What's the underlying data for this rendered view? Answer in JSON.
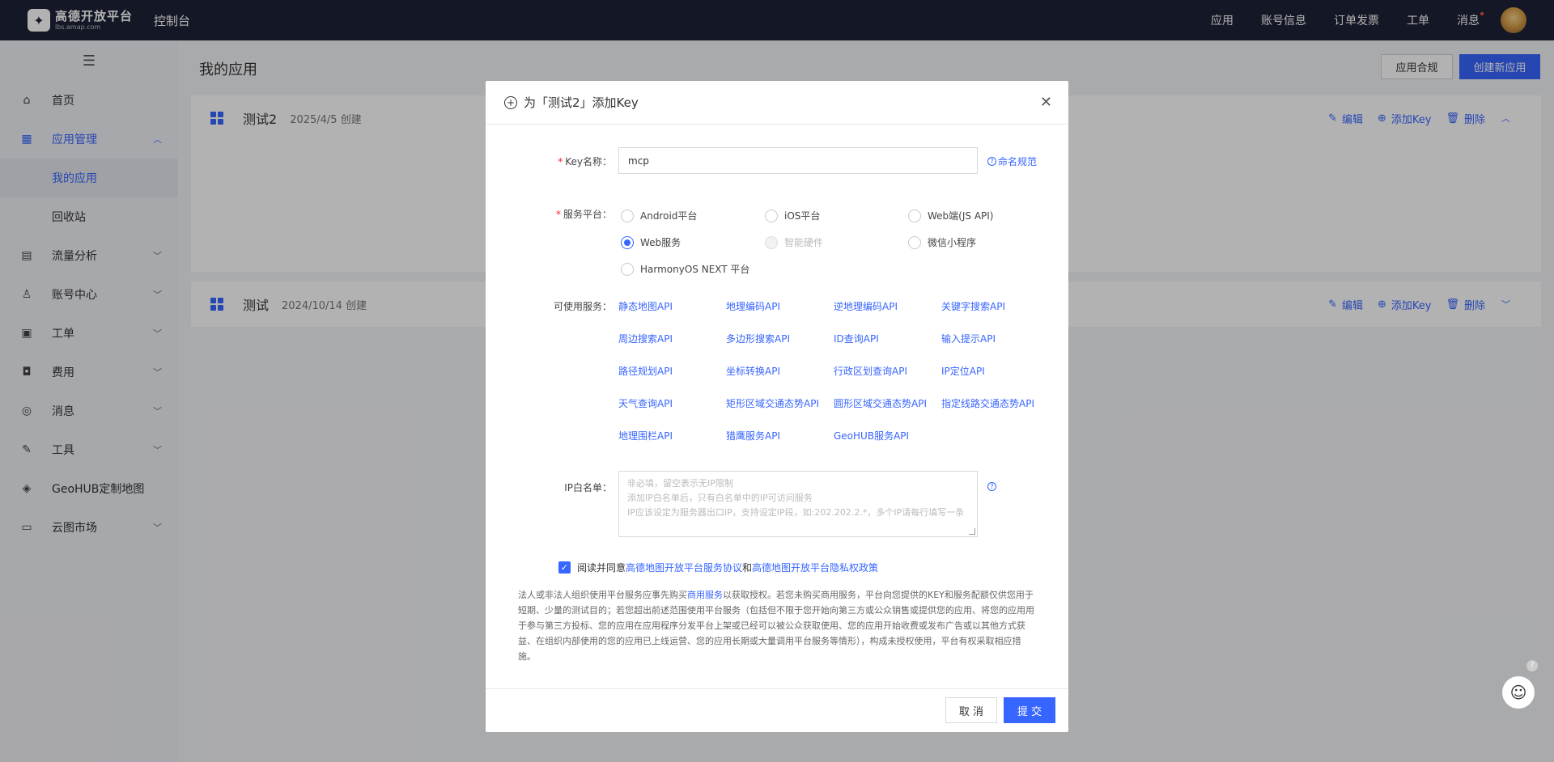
{
  "topbar": {
    "logo_main": "高德开放平台",
    "logo_sub": "lbs.amap.com",
    "console": "控制台",
    "nav": [
      "应用",
      "账号信息",
      "订单发票",
      "工单",
      "消息"
    ]
  },
  "sidebar": {
    "toggle_icon": "hamburger-icon",
    "items": [
      {
        "label": "首页",
        "icon": "home-icon"
      },
      {
        "label": "应用管理",
        "icon": "apps-icon"
      },
      {
        "label": "我的应用"
      },
      {
        "label": "回收站"
      },
      {
        "label": "流量分析",
        "icon": "chart-icon"
      },
      {
        "label": "账号中心",
        "icon": "user-icon"
      },
      {
        "label": "工单",
        "icon": "ticket-icon"
      },
      {
        "label": "费用",
        "icon": "billing-icon"
      },
      {
        "label": "消息",
        "icon": "message-icon"
      },
      {
        "label": "工具",
        "icon": "wrench-icon"
      },
      {
        "label": "GeoHUB定制地图",
        "icon": "layers-icon"
      },
      {
        "label": "云图市场",
        "icon": "store-icon"
      }
    ]
  },
  "main": {
    "title": "我的应用",
    "compliance_button": "应用合规",
    "create_button": "创建新应用",
    "apps": [
      {
        "name": "测试2",
        "date": "2025/4/5 创建",
        "edit": "编辑",
        "add_key": "添加Key",
        "delete": "删除"
      },
      {
        "name": "测试",
        "date": "2024/10/14 创建",
        "edit": "编辑",
        "add_key": "添加Key",
        "delete": "删除"
      }
    ]
  },
  "modal": {
    "title": "为「测试2」添加Key",
    "key_name_label": "Key名称：",
    "key_name_value": "mcp",
    "naming_link": "命名规范",
    "platform_label": "服务平台：",
    "platforms": [
      "Android平台",
      "iOS平台",
      "Web端(JS API)",
      "Web服务",
      "智能硬件",
      "微信小程序",
      "HarmonyOS NEXT 平台"
    ],
    "selected_platform": "Web服务",
    "services_label": "可使用服务：",
    "services": [
      "静态地图API",
      "地理编码API",
      "逆地理编码API",
      "关键字搜索API",
      "周边搜索API",
      "多边形搜索API",
      "ID查询API",
      "输入提示API",
      "路径规划API",
      "坐标转换API",
      "行政区划查询API",
      "IP定位API",
      "天气查询API",
      "矩形区域交通态势API",
      "圆形区域交通态势API",
      "指定线路交通态势API",
      "地理围栏API",
      "猎鹰服务API",
      "GeoHUB服务API"
    ],
    "ip_label": "IP白名单：",
    "ip_placeholder_1": "非必填，留空表示无IP限制",
    "ip_placeholder_2": "添加IP白名单后，只有白名单中的IP可访问服务",
    "ip_placeholder_3": "IP应该设定为服务器出口IP，支持设定IP段，如:202.202.2.*，多个IP请每行填写一条",
    "agree_prefix": "阅读并同意 ",
    "agree_link_1": "高德地图开放平台服务协议",
    "agree_and": " 和 ",
    "agree_link_2": "高德地图开放平台隐私权政策",
    "notice_1": "法人或非法人组织使用平台服务应事先购买",
    "notice_link": "商用服务",
    "notice_2": "以获取授权。若您未购买商用服务，平台向您提供的KEY和服务配额仅供您用于短期、少量的测试目的；若您超出前述范围使用平台服务（包括但不限于您开始向第三方或公众销售或提供您的应用、将您的应用用于参与第三方投标、您的应用在应用程序分发平台上架或已经可以被公众获取使用、您的应用开始收费或发布广告或以其他方式获益、在组织内部使用的您的应用已上线运营、您的应用长期或大量调用平台服务等情形），构成未授权使用，平台有权采取相应措施。",
    "cancel": "取 消",
    "submit": "提 交"
  }
}
